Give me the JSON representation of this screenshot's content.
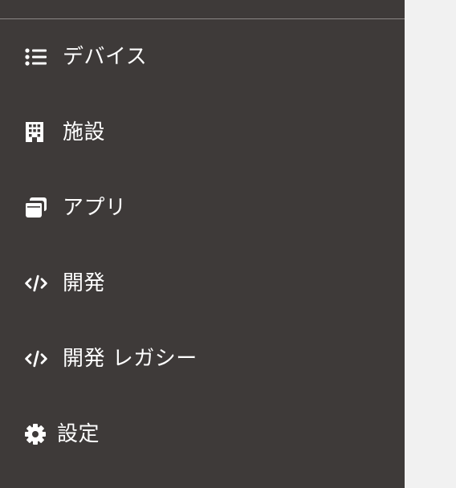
{
  "sidebar": {
    "items": [
      {
        "label": "デバイス",
        "icon": "list-icon"
      },
      {
        "label": "施設",
        "icon": "building-icon"
      },
      {
        "label": "アプリ",
        "icon": "windows-icon"
      },
      {
        "label": "開発",
        "icon": "code-icon"
      },
      {
        "label": "開発 レガシー",
        "icon": "code-icon"
      },
      {
        "label": "設定",
        "icon": "gear-icon"
      }
    ]
  },
  "colors": {
    "sidebar_background": "#3e3a39",
    "page_background": "#f1f1f1",
    "divider": "#8a8786",
    "text": "#ffffff"
  }
}
